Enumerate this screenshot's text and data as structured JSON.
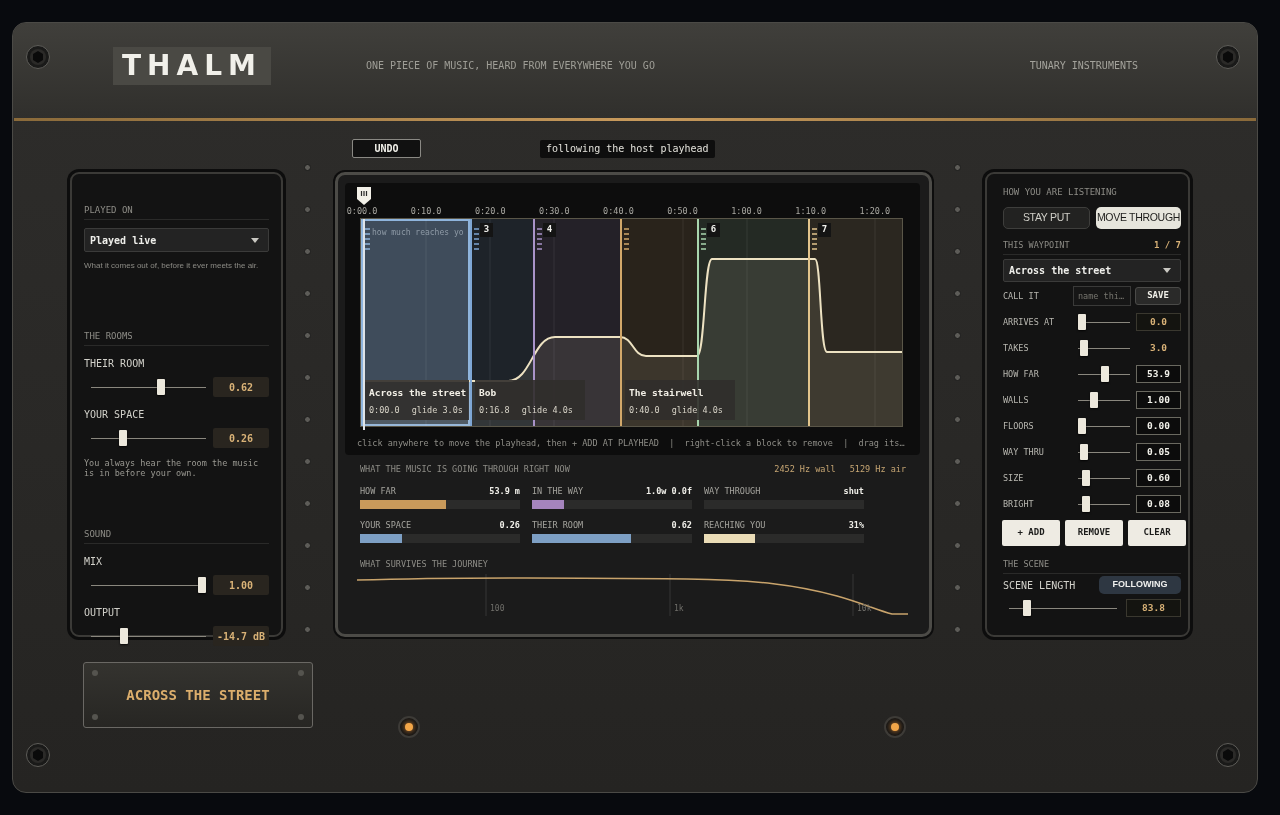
{
  "header": {
    "logo": "THALM",
    "tagline": "ONE PIECE OF MUSIC, HEARD FROM EVERYWHERE YOU GO",
    "maker": "TUNARY INSTRUMENTS"
  },
  "left_panel": {
    "sections": [
      {
        "title": "PLAYED ON",
        "items": [
          {
            "kind": "select",
            "value": "Played live"
          },
          {
            "kind": "hint",
            "text": "What it comes out of, before it ever meets the air."
          }
        ]
      },
      {
        "title": "THE ROOMS",
        "items": [
          {
            "kind": "slider",
            "label": "THEIR ROOM",
            "level": 0.62,
            "reading": "0.62"
          },
          {
            "kind": "slider",
            "label": "YOUR SPACE",
            "level": 0.26,
            "reading": "0.26"
          },
          {
            "kind": "note",
            "text": "You always hear the room the music is in before your own."
          }
        ]
      },
      {
        "title": "SOUND",
        "items": [
          {
            "kind": "slider",
            "label": "MIX",
            "level": 1,
            "reading": "1.00"
          },
          {
            "kind": "slider",
            "label": "OUTPUT",
            "level": 0.27,
            "reading": "-14.7 dB"
          }
        ]
      }
    ]
  },
  "toolbar": {
    "undo": "UNDO",
    "status": "following the host playhead"
  },
  "timeline": {
    "ruler": [
      "0:00.0",
      "0:10.0",
      "0:20.0",
      "0:30.0",
      "0:40.0",
      "0:50.0",
      "1:00.0",
      "1:10.0",
      "1:20.0"
    ],
    "curve_label": "how much reaches yo",
    "blocks": [
      {
        "color": "#8fb4dc",
        "selected": true
      },
      {
        "color": "#7ea6d4",
        "selected": false,
        "badge": "3"
      },
      {
        "color": "#a993c9",
        "selected": false,
        "badge": "4"
      },
      {
        "color": "#d2a86a",
        "selected": false
      },
      {
        "color": "#a9d6ae",
        "selected": false,
        "badge": "6"
      },
      {
        "color": "#e2c58c",
        "selected": false,
        "badge": "7"
      }
    ],
    "cards": [
      {
        "name": "Across the street",
        "time": "0:00.0",
        "glide": "glide 3.0s"
      },
      {
        "name": "Bob",
        "time": "0:16.8",
        "glide": "glide 4.0s"
      },
      {
        "name": "The stairwell",
        "time": "0:40.0",
        "glide": "glide 4.0s"
      }
    ],
    "hint": "click anywhere to move the playhead, then + ADD AT PLAYHEAD  |  right-click a block to remove  |  drag its…"
  },
  "meters": {
    "title": "WHAT THE MUSIC IS GOING THROUGH RIGHT NOW",
    "readouts": [
      "2452 Hz wall",
      "5129 Hz air"
    ],
    "bars": [
      {
        "label": "HOW FAR",
        "reading": "53.9 m",
        "level": 0.54,
        "color": "#c99a5b"
      },
      {
        "label": "IN THE WAY",
        "reading": "1.0w 0.0f",
        "level": 0.2,
        "color": "#a584bd"
      },
      {
        "label": "WAY THROUGH",
        "reading": "shut"
      },
      {
        "label": "YOUR SPACE",
        "reading": "0.26",
        "level": 0.26,
        "color": "#7d9fc4"
      },
      {
        "label": "THEIR ROOM",
        "reading": "0.62",
        "level": 0.62,
        "color": "#7d9fc4"
      },
      {
        "label": "REACHING YOU",
        "reading": "31%",
        "level": 0.32,
        "color": "#eadcb6"
      }
    ]
  },
  "response": {
    "title": "WHAT SURVIVES THE JOURNEY",
    "ticks": [
      "100",
      "1k",
      "10k"
    ]
  },
  "right_panel": {
    "listening": {
      "title": "HOW YOU ARE LISTENING",
      "modes": [
        {
          "label": "STAY PUT",
          "selected": false
        },
        {
          "label": "MOVE THROUGH",
          "selected": true
        }
      ]
    },
    "waypoint": {
      "title": "THIS WAYPOINT",
      "counter": "1 / 7",
      "select": "Across the street",
      "name_label": "CALL IT",
      "name_placeholder": "name thi…",
      "save": "SAVE",
      "params": [
        {
          "kind": "setting",
          "label": "ARRIVES AT",
          "level": 0,
          "reading": "0.0"
        },
        {
          "kind": "derived",
          "label": "TAKES",
          "level": 0.05,
          "reading": "3.0"
        },
        {
          "kind": "field",
          "label": "HOW FAR",
          "level": 0.53,
          "reading": "53.9"
        },
        {
          "kind": "field",
          "label": "WALLS",
          "level": 0.28,
          "reading": "1.00"
        },
        {
          "kind": "field",
          "label": "FLOORS",
          "level": 0,
          "reading": "0.00"
        },
        {
          "kind": "field",
          "label": "WAY THRU",
          "level": 0.05,
          "reading": "0.05"
        },
        {
          "kind": "field",
          "label": "SIZE",
          "level": 0.08,
          "reading": "0.60"
        },
        {
          "kind": "field",
          "label": "BRIGHT",
          "level": 0.1,
          "reading": "0.08"
        }
      ]
    },
    "actions": [
      "+ ADD",
      "REMOVE",
      "CLEAR"
    ],
    "scene": {
      "title": "THE SCENE",
      "label": "SCENE LENGTH",
      "status": "FOLLOWING",
      "level": 0.14,
      "reading": "83.8"
    }
  },
  "plate": "ACROSS THE STREET"
}
